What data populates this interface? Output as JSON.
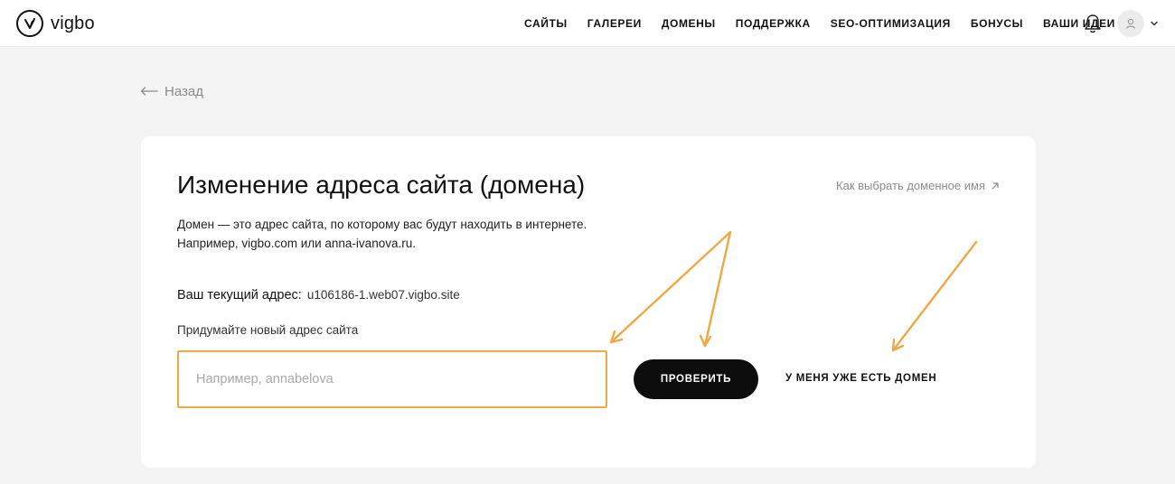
{
  "header": {
    "logo_text": "vigbo",
    "nav": [
      {
        "label": "САЙТЫ"
      },
      {
        "label": "ГАЛЕРЕИ"
      },
      {
        "label": "ДОМЕНЫ"
      },
      {
        "label": "ПОДДЕРЖКА"
      },
      {
        "label": "SEO-ОПТИМИЗАЦИЯ"
      },
      {
        "label": "БОНУСЫ"
      },
      {
        "label": "ВАШИ ИДЕИ"
      }
    ],
    "icons": {
      "notifications": "bell-icon",
      "user": "user-avatar-icon",
      "menu": "chevron-down-icon"
    }
  },
  "back": {
    "label": "Назад",
    "icon": "arrow-left-icon"
  },
  "card": {
    "title": "Изменение адреса сайта (домена)",
    "help_link": "Как выбрать доменное имя",
    "help_icon": "external-link-icon",
    "description_line1": "Домен — это адрес сайта, по которому вас будут находить в интернете.",
    "description_line2": "Например, vigbo.com или anna-ivanova.ru.",
    "current_label": "Ваш текущий адрес:",
    "current_value": "u106186-1.web07.vigbo.site",
    "new_label": "Придумайте новый адрес сайта",
    "input_value": "",
    "input_placeholder": "Например, annabelova",
    "check_button": "ПРОВЕРИТЬ",
    "have_domain_link": "У МЕНЯ УЖЕ ЕСТЬ ДОМЕН"
  },
  "colors": {
    "accent_annotation": "#eea845",
    "background": "#f4f4f4",
    "button": "#0d0d0d"
  }
}
